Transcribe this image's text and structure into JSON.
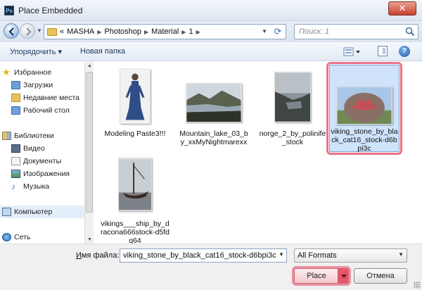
{
  "window": {
    "app_icon": "Ps",
    "title": "Place Embedded",
    "close_glyph": "✕"
  },
  "nav": {
    "breadcrumbs": [
      "«",
      "MASHA",
      "Photoshop",
      "Material",
      "1"
    ],
    "search_placeholder": "Поиск: 1"
  },
  "toolbar": {
    "organize": "Упорядочить ▾",
    "new_folder": "Новая папка",
    "help": "?"
  },
  "sidebar": {
    "favorites": "Избранное",
    "downloads": "Загрузки",
    "recent": "Недавние места",
    "desktop": "Рабочий стол",
    "libraries": "Библиотеки",
    "video": "Видео",
    "documents": "Документы",
    "images": "Изображения",
    "music": "Музыка",
    "computer": "Компьютер",
    "network": "Сеть"
  },
  "files": [
    {
      "name": "Modeling Paste3!!!"
    },
    {
      "name": "Mountain_lake_03_by_xxMyNightmarexx"
    },
    {
      "name": "norge_2_by_polinife_stock"
    },
    {
      "name": "viking_stone_by_black_cat16_stock-d6bpi3c"
    },
    {
      "name": "vikings___ship_by_dracona666stock-d5fdq64"
    }
  ],
  "bottom": {
    "filename_label_u": "И",
    "filename_label_rest": "мя файла:",
    "filename_value": "viking_stone_by_black_cat16_stock-d6bpi3c",
    "filetype_value": "All Formats",
    "place_label": "Place",
    "cancel_label": "Отмена"
  },
  "colors": {
    "highlight": "#e24662",
    "selection": "#cfe3fb",
    "chrome": "#dde6f1"
  }
}
